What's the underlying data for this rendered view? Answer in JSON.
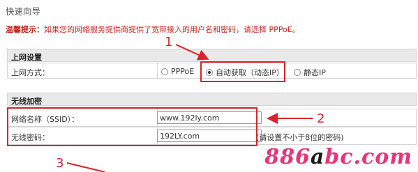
{
  "page": {
    "title": "快速向导",
    "tip_label": "温馨提示：",
    "tip_text": "如果您的网络服务提供商提供了宽带接入的用户名和密码，请选择 PPPoE。"
  },
  "internet": {
    "section_title": "上网设置",
    "method_label": "上网方式：",
    "options": [
      "PPPoE",
      "自动获取（动态IP）",
      "静态IP"
    ],
    "selected": "自动获取（动态IP）"
  },
  "wireless": {
    "section_title": "无线加密",
    "ssid_label": "网络名称（SSID）：",
    "ssid_value": "www.192ly.com",
    "password_label": "无线密码：",
    "password_value": "192LY.com",
    "password_hint": "(请设置不小于8位的密码)"
  },
  "annotations": {
    "step1": "1",
    "step2": "2",
    "step3": "3",
    "accent_color": "#d9232d"
  },
  "watermark": {
    "text_a": "886",
    "text_b": "a",
    "text_c": "bc.com"
  }
}
